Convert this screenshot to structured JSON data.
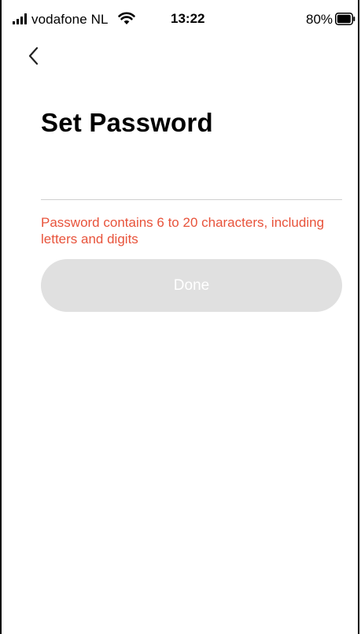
{
  "status_bar": {
    "carrier": "vodafone NL",
    "time": "13:22",
    "battery_percent": "80%",
    "icons": [
      "signal-icon",
      "wifi-icon",
      "battery-icon"
    ]
  },
  "nav": {
    "back_icon": "chevron-left-icon"
  },
  "page": {
    "title": "Set Password"
  },
  "form": {
    "password_value": "",
    "password_placeholder": "",
    "hint": "Password contains 6 to 20 characters, including letters and digits",
    "done_label": "Done"
  },
  "colors": {
    "hint": "#e8533b",
    "button_disabled_bg": "#e0e0e0",
    "button_text": "#ffffff",
    "divider": "#cfcfcf"
  }
}
